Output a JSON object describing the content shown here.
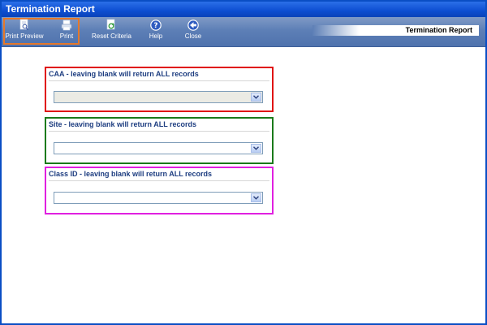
{
  "window": {
    "title": "Termination Report"
  },
  "toolbar": {
    "print_preview_label": "Print Preview",
    "print_label": "Print",
    "reset_label": "Reset Criteria",
    "help_label": "Help",
    "close_label": "Close",
    "report_title": "Termination Report"
  },
  "filters": {
    "caa": {
      "label": "CAA - leaving blank will return ALL records",
      "value": "",
      "border_color": "#e01010"
    },
    "site": {
      "label": "Site - leaving blank will return ALL records",
      "value": "",
      "border_color": "#1a7a1a"
    },
    "class_id": {
      "label": "Class ID - leaving blank will return ALL records",
      "value": "",
      "border_color": "#e020e0"
    }
  },
  "colors": {
    "toolbar_accent": "#e5782a",
    "title_bar": "#0d4ed1"
  }
}
